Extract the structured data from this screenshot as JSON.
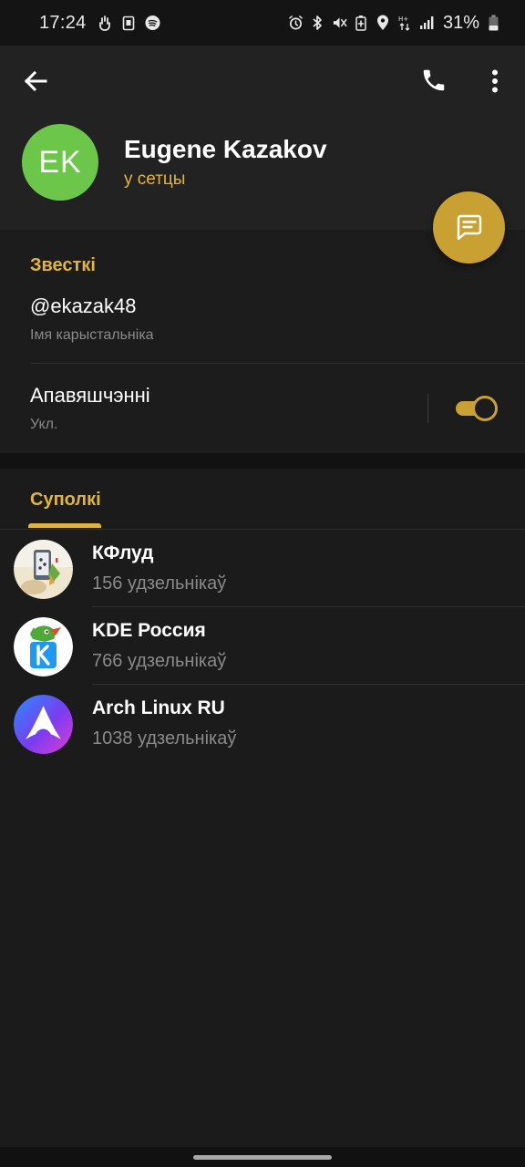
{
  "status_bar": {
    "time": "17:24",
    "battery": "31%",
    "left_icons": [
      "hand-icon",
      "sim-icon",
      "spotify-icon"
    ],
    "right_icons": [
      "alarm-icon",
      "bluetooth-icon",
      "mute-icon",
      "battery-saver-icon",
      "location-icon",
      "data-icon",
      "signal-icon",
      "battery-icon"
    ]
  },
  "header": {
    "back_icon": "arrow-left-icon",
    "call_icon": "phone-icon",
    "menu_icon": "more-vert-icon",
    "avatar_initials": "EK",
    "avatar_color": "#6cc64a",
    "name": "Eugene Kazakov",
    "status": "у сетцы"
  },
  "fab": {
    "icon": "message-icon",
    "color": "#c9a032"
  },
  "info": {
    "section_title": "Звесткі",
    "username": "@ekazak48",
    "username_label": "Імя карыстальніка",
    "notifications_title": "Апавяшчэнні",
    "notifications_value": "Укл.",
    "notifications_enabled": true
  },
  "tabs": {
    "groups_label": "Суполкі"
  },
  "groups": [
    {
      "name": "КФлуд",
      "members": "156 удзельнікаў"
    },
    {
      "name": "KDE Россия",
      "members": "766 удзельнікаў"
    },
    {
      "name": "Arch Linux RU",
      "members": "1038 удзельнікаў"
    }
  ],
  "colors": {
    "accent": "#e0b441",
    "background": "#1b1b1b",
    "header": "#222222"
  }
}
